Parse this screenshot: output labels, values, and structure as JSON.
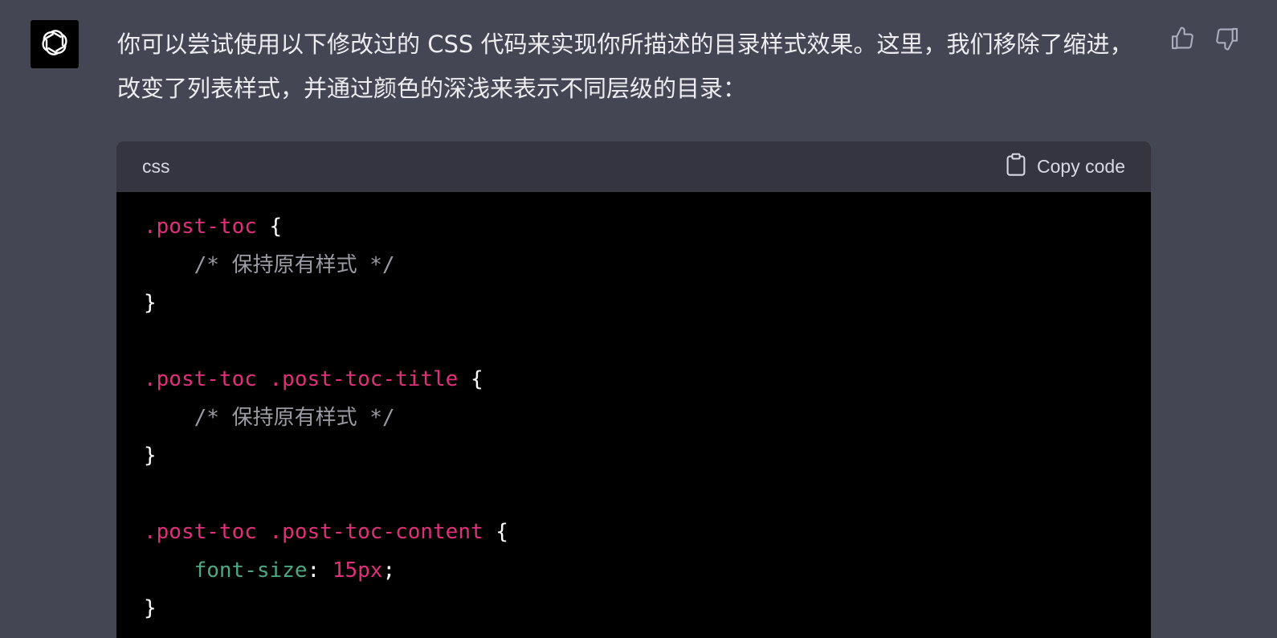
{
  "message": {
    "text": "你可以尝试使用以下修改过的 CSS 代码来实现你所描述的目录样式效果。这里，我们移除了缩进，改变了列表样式，并通过颜色的深浅来表示不同层级的目录："
  },
  "avatar": {
    "icon": "openai-logo-icon"
  },
  "feedback": {
    "thumbs_up_icon": "thumbs-up-icon",
    "thumbs_down_icon": "thumbs-down-icon"
  },
  "code_block": {
    "language": "css",
    "copy_label": "Copy code",
    "lines": [
      [
        {
          "t": ".post-toc",
          "k": "selector"
        },
        {
          "t": " {",
          "k": "punct"
        }
      ],
      [
        {
          "t": "    /* 保持原有样式 */",
          "k": "comment"
        }
      ],
      [
        {
          "t": "}",
          "k": "punct"
        }
      ],
      [],
      [
        {
          "t": ".post-toc .post-toc-title",
          "k": "selector"
        },
        {
          "t": " {",
          "k": "punct"
        }
      ],
      [
        {
          "t": "    /* 保持原有样式 */",
          "k": "comment"
        }
      ],
      [
        {
          "t": "}",
          "k": "punct"
        }
      ],
      [],
      [
        {
          "t": ".post-toc .post-toc-content",
          "k": "selector"
        },
        {
          "t": " {",
          "k": "punct"
        }
      ],
      [
        {
          "t": "    ",
          "k": "punct"
        },
        {
          "t": "font-size",
          "k": "prop"
        },
        {
          "t": ": ",
          "k": "punct"
        },
        {
          "t": "15px",
          "k": "value"
        },
        {
          "t": ";",
          "k": "punct"
        }
      ],
      [
        {
          "t": "}",
          "k": "punct"
        }
      ]
    ]
  },
  "colors": {
    "background": "#444654",
    "code_header": "#343541",
    "code_body": "#000000",
    "selector": "#df3079",
    "comment": "#9b9ba3",
    "property": "#4ea887"
  }
}
